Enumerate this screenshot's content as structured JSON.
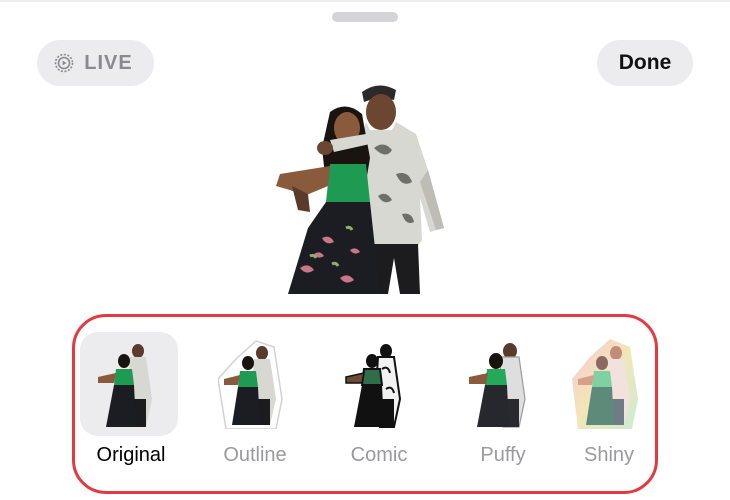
{
  "header": {
    "live_label": "LIVE",
    "live_icon": "live-photo-icon",
    "done_label": "Done"
  },
  "preview": {
    "subject": "sticker-subject"
  },
  "effects": {
    "selected": "Original",
    "options": [
      {
        "label": "Original"
      },
      {
        "label": "Outline"
      },
      {
        "label": "Comic"
      },
      {
        "label": "Puffy"
      },
      {
        "label": "Shiny"
      }
    ]
  },
  "colors": {
    "highlight_border": "#e53940",
    "pill_bg": "#ececee",
    "label_inactive": "#9a9a9e"
  }
}
